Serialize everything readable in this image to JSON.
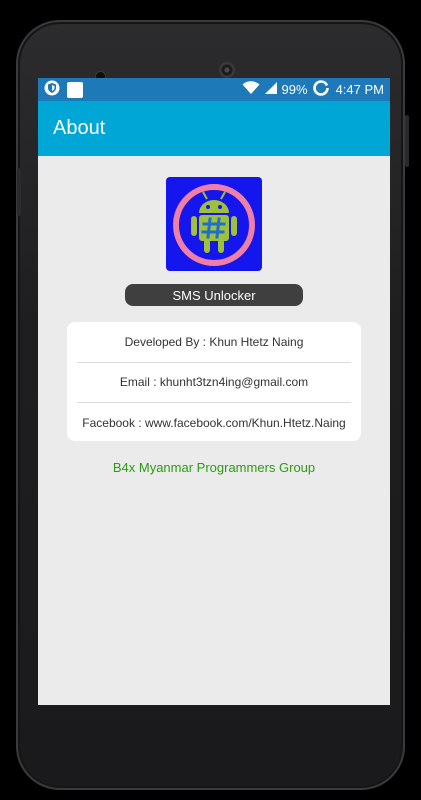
{
  "status_bar": {
    "battery": "99%",
    "time": "4:47 PM"
  },
  "app_bar": {
    "title": "About"
  },
  "app": {
    "name": "SMS Unlocker",
    "icon": "android-hash-icon"
  },
  "info": {
    "developer": "Developed By : Khun Htetz Naing",
    "email": "Email : khunht3tzn4ing@gmail.com",
    "facebook": "Facebook : www.facebook.com/Khun.Htetz.Naing"
  },
  "group_link": "B4x Myanmar Programmers Group",
  "colors": {
    "status_bar": "#1d79b8",
    "app_bar": "#00a6d6",
    "link_green": "#2e9a12",
    "logo_bg": "#1515ee",
    "logo_ring": "#f07fa8",
    "android_green": "#9fc13a"
  }
}
